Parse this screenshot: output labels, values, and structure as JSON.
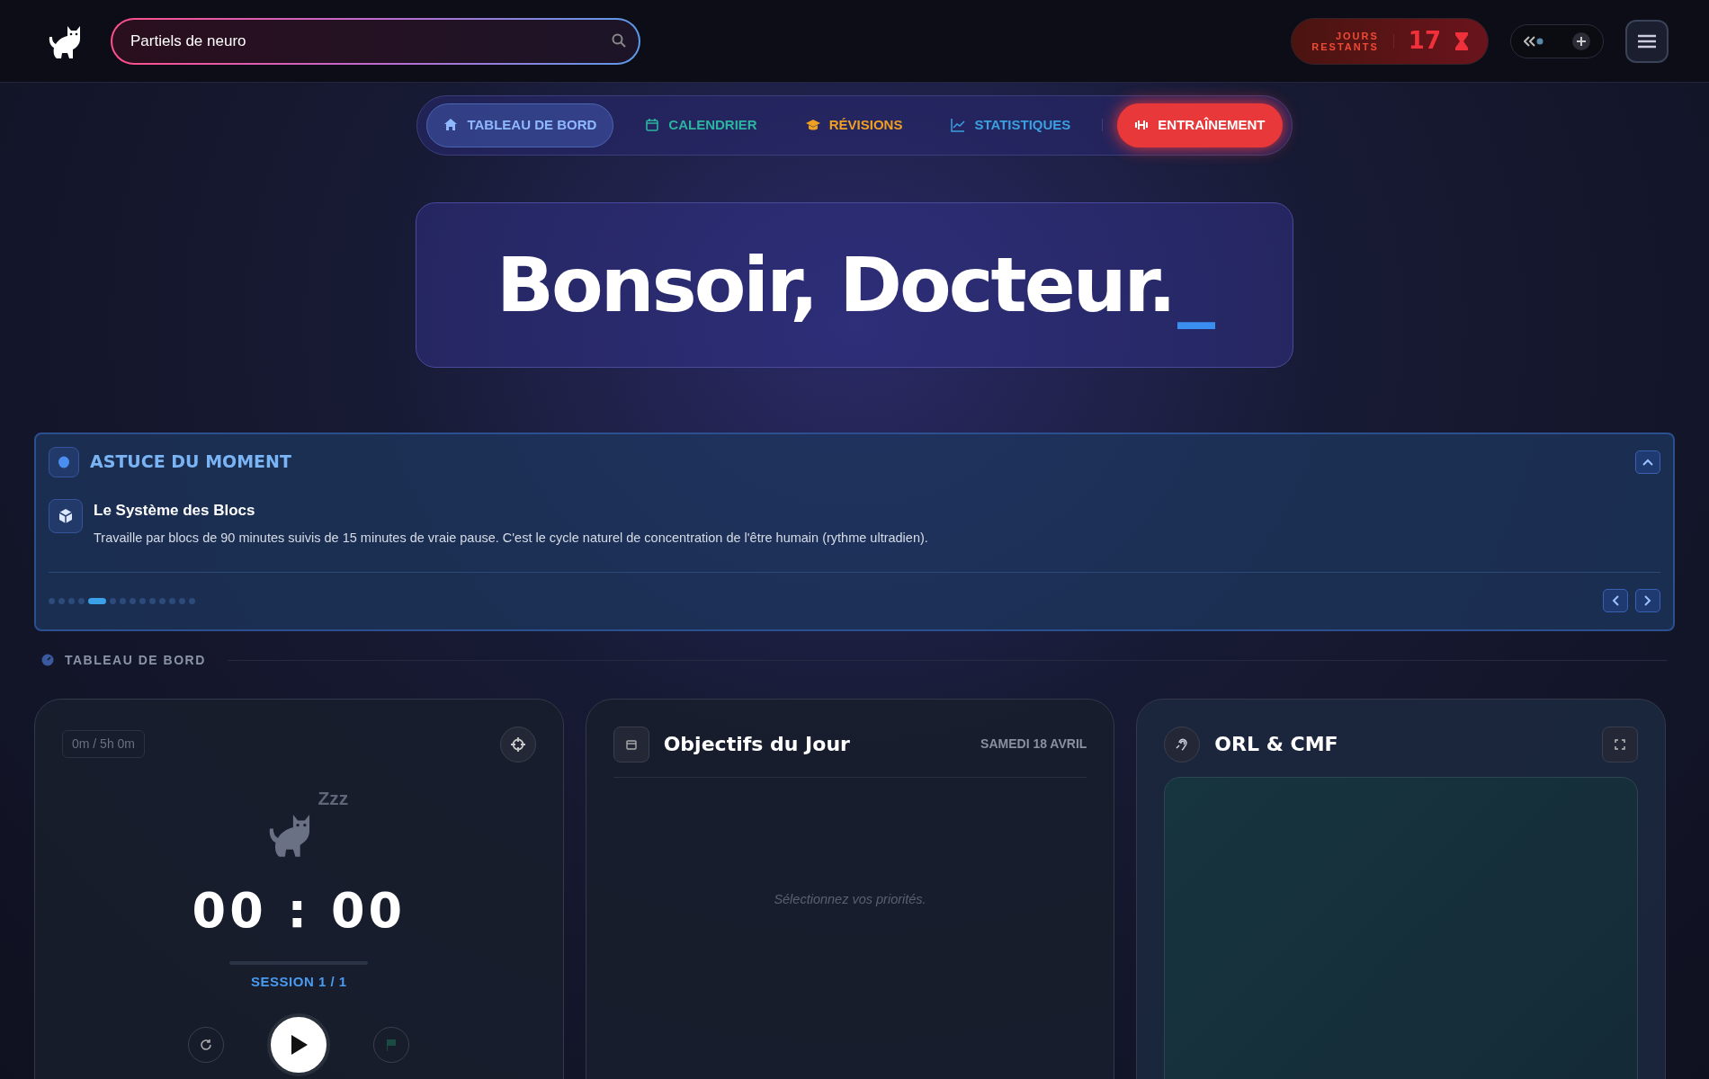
{
  "search": {
    "value": "Partiels de neuro"
  },
  "countdown": {
    "label_top": "JOURS",
    "label_bottom": "RESTANTS",
    "days": "17"
  },
  "nav": [
    {
      "label": "TABLEAU DE BORD",
      "selected": true,
      "kind": "tab"
    },
    {
      "label": "CALENDRIER",
      "selected": false,
      "kind": "tab"
    },
    {
      "label": "RÉVISIONS",
      "selected": false,
      "kind": "tab"
    },
    {
      "label": "STATISTIQUES",
      "selected": false,
      "kind": "tab"
    },
    {
      "label": "ENTRAÎNEMENT",
      "selected": false,
      "kind": "cta"
    }
  ],
  "greeting": {
    "text": "Bonsoir, Docteur.",
    "cursor": "_"
  },
  "tip": {
    "heading": "ASTUCE DU MOMENT",
    "title": "Le Système des Blocs",
    "body": "Travaille par blocs de 90 minutes suivis de 15 minutes de vraie pause. C'est le cycle naturel de concentration de l'être humain (rythme ultradien).",
    "dots": [
      {
        "selected": false
      },
      {
        "selected": false
      },
      {
        "selected": false
      },
      {
        "selected": false
      },
      {
        "selected": true
      },
      {
        "selected": false
      },
      {
        "selected": false
      },
      {
        "selected": false
      },
      {
        "selected": false
      },
      {
        "selected": false
      },
      {
        "selected": false
      },
      {
        "selected": false
      },
      {
        "selected": false
      },
      {
        "selected": false
      }
    ]
  },
  "section_title": "TABLEAU DE BORD",
  "timer": {
    "progress_text": "0m / 5h 0m",
    "sleep": "Zzz",
    "time": "00 : 00",
    "session": "SESSION 1 / 1"
  },
  "objectives": {
    "title": "Objectifs du Jour",
    "date": "SAMEDI 18 AVRIL",
    "empty": "Sélectionnez vos priorités."
  },
  "subject": {
    "title": "ORL & CMF"
  }
}
